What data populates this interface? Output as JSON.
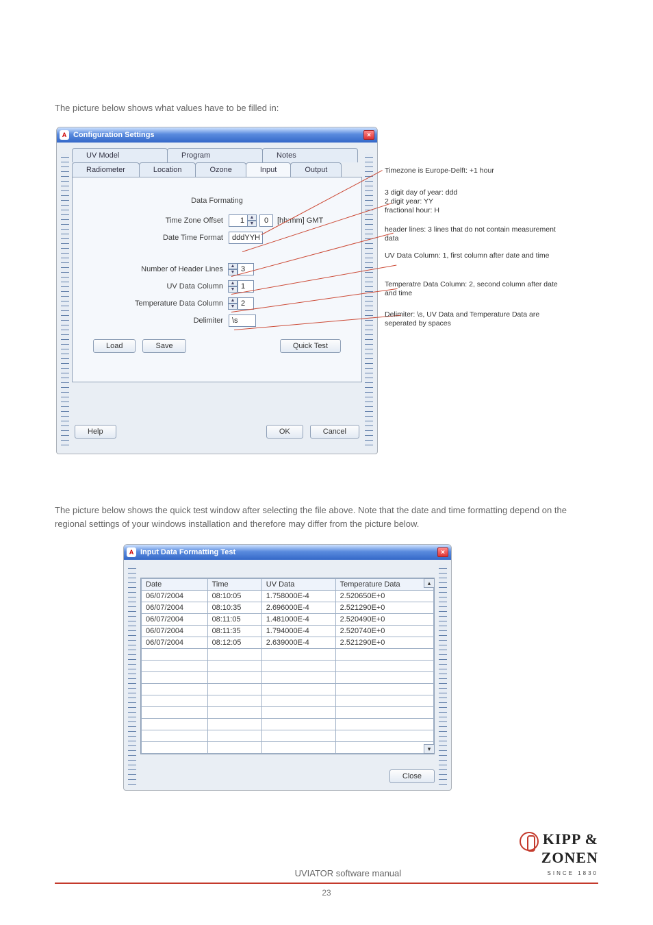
{
  "intro1": "The picture below shows what values have to be filled in:",
  "intro2": "The picture below shows the quick test window after selecting the file above. Note that the date and time formatting depend on the regional settings of your windows installation and therefore may differ from the picture below.",
  "win1": {
    "title": "Configuration Settings",
    "tabs_back": [
      "UV Model",
      "Program",
      "Notes"
    ],
    "tabs_front": [
      "Radiometer",
      "Location",
      "Ozone",
      "Input",
      "Output"
    ],
    "section": "Data Formating",
    "fields": {
      "tz_label": "Time Zone Offset",
      "tz_hh": "1",
      "tz_mm": "0",
      "tz_unit": "[hh:mm] GMT",
      "dtf_label": "Date Time Format",
      "dtf_value": "dddYYH",
      "hdr_label": "Number of Header Lines",
      "hdr_value": "3",
      "uvcol_label": "UV Data Column",
      "uvcol_value": "1",
      "tcol_label": "Temperature Data Column",
      "tcol_value": "2",
      "delim_label": "Delimiter",
      "delim_value": "\\s"
    },
    "buttons": {
      "load": "Load",
      "save": "Save",
      "quick": "Quick Test",
      "help": "Help",
      "ok": "OK",
      "cancel": "Cancel"
    }
  },
  "annotations": {
    "a1": "Timezone is Europe-Delft: +1 hour",
    "a2": "3 digit day of year: ddd\n2 digit year: YY\nfractional hour: H",
    "a3": "header lines: 3 lines that do not contain measurement data",
    "a4": "UV Data Column: 1, first column after date and time",
    "a5": "Temperatre Data Column: 2, second column after date and time",
    "a6": "Delimiter: \\s, UV Data and Temperature Data are seperated by spaces"
  },
  "win2": {
    "title": "Input Data Formatting Test",
    "headers": [
      "Date",
      "Time",
      "UV Data",
      "Temperature Data"
    ],
    "rows": [
      [
        "06/07/2004",
        "08:10:05",
        "1.758000E-4",
        "2.520650E+0"
      ],
      [
        "06/07/2004",
        "08:10:35",
        "2.696000E-4",
        "2.521290E+0"
      ],
      [
        "06/07/2004",
        "08:11:05",
        "1.481000E-4",
        "2.520490E+0"
      ],
      [
        "06/07/2004",
        "08:11:35",
        "1.794000E-4",
        "2.520740E+0"
      ],
      [
        "06/07/2004",
        "08:12:05",
        "2.639000E-4",
        "2.521290E+0"
      ]
    ],
    "close": "Close"
  },
  "footer": {
    "title": "UVIATOR software manual",
    "brand1": "KIPP &",
    "brand2": "ZONEN",
    "since": "SINCE 1830",
    "page": "23"
  },
  "chart_data": {
    "type": "table",
    "title": "Input Data Formatting Test",
    "columns": [
      "Date",
      "Time",
      "UV Data",
      "Temperature Data"
    ],
    "rows": [
      [
        "06/07/2004",
        "08:10:05",
        0.0001758,
        2.52065
      ],
      [
        "06/07/2004",
        "08:10:35",
        0.0002696,
        2.52129
      ],
      [
        "06/07/2004",
        "08:11:05",
        0.0001481,
        2.52049
      ],
      [
        "06/07/2004",
        "08:11:35",
        0.0001794,
        2.52074
      ],
      [
        "06/07/2004",
        "08:12:05",
        0.0002639,
        2.52129
      ]
    ]
  }
}
